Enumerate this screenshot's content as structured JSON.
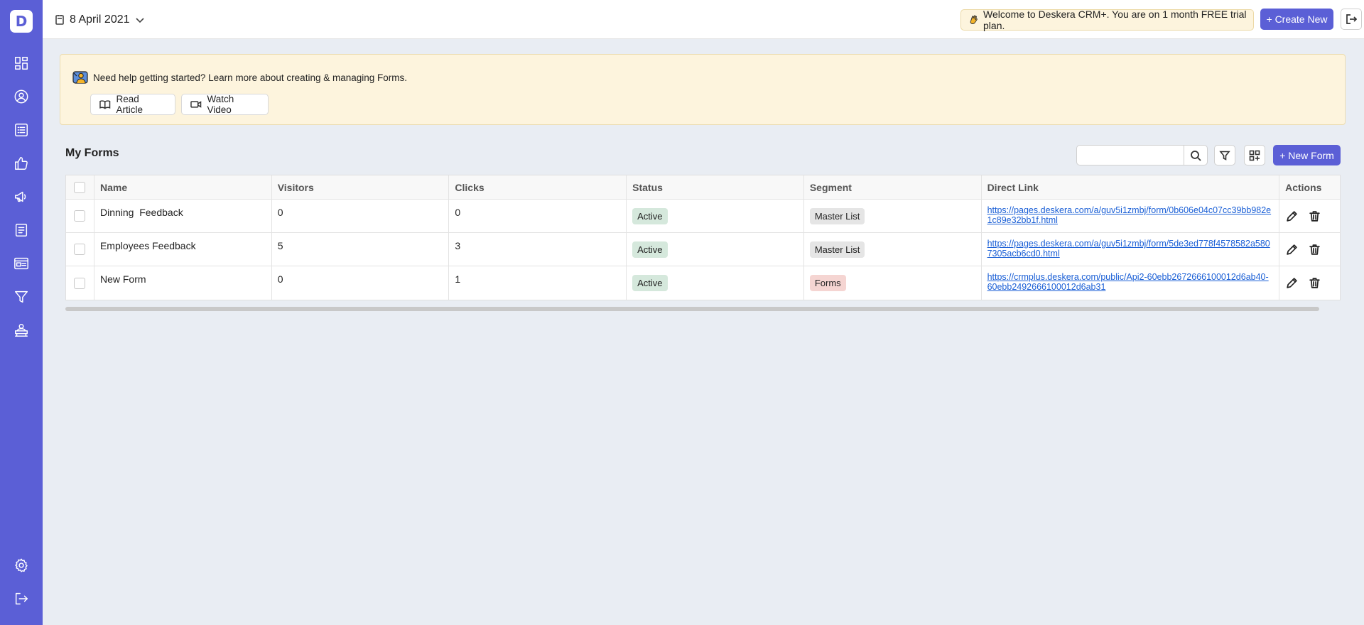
{
  "sidebar": {
    "logo": "D",
    "items": [
      {
        "name": "dashboard-icon"
      },
      {
        "name": "contacts-icon"
      },
      {
        "name": "list-icon"
      },
      {
        "name": "deals-thumb-icon"
      },
      {
        "name": "campaign-megaphone-icon"
      },
      {
        "name": "clipboard-icon"
      },
      {
        "name": "forms-card-icon"
      },
      {
        "name": "funnel-icon"
      },
      {
        "name": "support-desk-icon"
      }
    ],
    "bottom": [
      {
        "name": "settings-gear-icon"
      },
      {
        "name": "logout-icon"
      }
    ]
  },
  "topbar": {
    "date": "8 April 2021",
    "welcome": "Welcome to Deskera CRM+. You are on 1 month FREE trial plan.",
    "create_new": "+ Create New"
  },
  "help": {
    "text": "Need help getting started? Learn more about creating & managing Forms.",
    "read_article": "Read Article",
    "watch_video": "Watch Video"
  },
  "forms": {
    "title": "My Forms",
    "search_placeholder": "",
    "new_form": "+ New Form",
    "columns": [
      "Name",
      "Visitors",
      "Clicks",
      "Status",
      "Segment",
      "Direct Link",
      "Actions"
    ],
    "rows": [
      {
        "name": "Dinning  Feedback",
        "visitors": "0",
        "clicks": "0",
        "status": "Active",
        "segment": "Master List",
        "link": "https://pages.deskera.com/a/guv5i1zmbj/form/0b606e04c07cc39bb982e1c89e32bb1f.html"
      },
      {
        "name": "Employees Feedback",
        "visitors": "5",
        "clicks": "3",
        "status": "Active",
        "segment": "Master List",
        "link": "https://pages.deskera.com/a/guv5i1zmbj/form/5de3ed778f4578582a5807305acb6cd0.html"
      },
      {
        "name": "New Form",
        "visitors": "0",
        "clicks": "1",
        "status": "Active",
        "segment": "Forms",
        "link": "https://crmplus.deskera.com/public/Api2-60ebb2672666100012d6ab40-60ebb2492666100012d6ab31"
      }
    ]
  },
  "colors": {
    "sidebar": "#5b5fd6",
    "primary": "#5b5fd6",
    "banner": "#fdf4dd",
    "link": "#1a5fd6"
  }
}
